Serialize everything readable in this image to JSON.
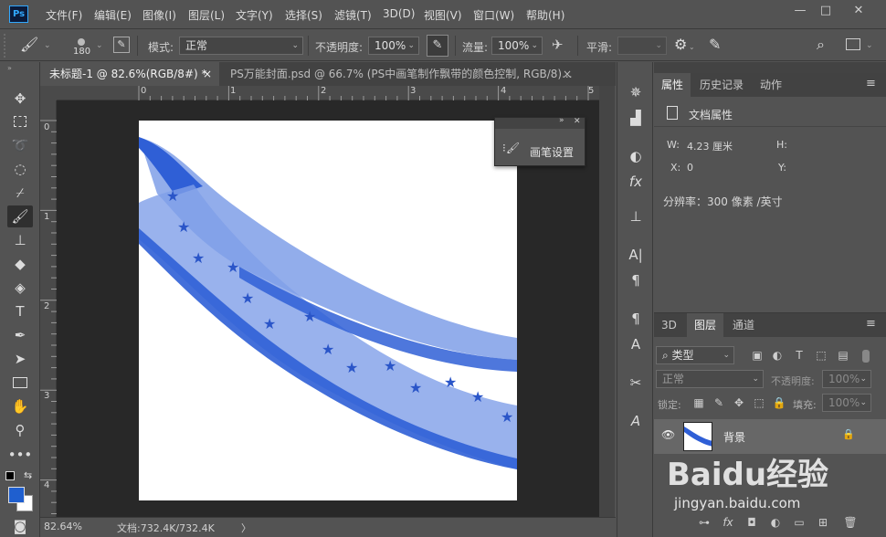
{
  "app": {
    "logo": "Ps"
  },
  "menu": [
    "文件(F)",
    "编辑(E)",
    "图像(I)",
    "图层(L)",
    "文字(Y)",
    "选择(S)",
    "滤镜(T)",
    "3D(D)",
    "视图(V)",
    "窗口(W)",
    "帮助(H)"
  ],
  "window_controls": {
    "minimize": "—",
    "maximize": "□",
    "close": "✕"
  },
  "options": {
    "brush_size": "180",
    "mode_label": "模式:",
    "mode_value": "正常",
    "opacity_label": "不透明度:",
    "opacity_value": "100%",
    "flow_label": "流量:",
    "flow_value": "100%",
    "smooth_label": "平滑:",
    "smooth_value": ""
  },
  "tabs": [
    {
      "label": "未标题-1 @ 82.6%(RGB/8#) *",
      "close": "×"
    },
    {
      "label": "PS万能封面.psd @ 66.7% (PS中画笔制作飘带的颜色控制, RGB/8)...",
      "close": "×"
    }
  ],
  "ruler_top": [
    "0",
    "1",
    "2",
    "3",
    "4",
    "5"
  ],
  "ruler_left": [
    "0",
    "1",
    "2",
    "3",
    "4"
  ],
  "brush_panel": {
    "title": "画笔设置"
  },
  "status": {
    "zoom": "82.64%",
    "doc_info": "文档:732.4K/732.4K",
    "arrow": "〉"
  },
  "properties": {
    "tabs": [
      "属性",
      "历史记录",
      "动作"
    ],
    "doc_title": "文档属性",
    "w_label": "W:",
    "w_value": "4.23 厘米",
    "h_label": "H:",
    "x_label": "X:",
    "x_value": "0",
    "y_label": "Y:",
    "resolution": "分辨率：300 像素 /英寸"
  },
  "layers": {
    "tabs": [
      "3D",
      "图层",
      "通道"
    ],
    "kind_label": "类型",
    "blend_mode": "正常",
    "opacity_label": "不透明度:",
    "opacity_value": "100%",
    "lock_label": "锁定:",
    "fill_label": "填充:",
    "fill_value": "100%",
    "layer_name": "背景"
  },
  "watermark": {
    "text": "Baidu经验",
    "url": "jingyan.baidu.com"
  },
  "colors": {
    "ribbon": "#2f5fd6",
    "ribbon_light": "#7f9fe8",
    "foreground": "#1f5fcf",
    "background": "#ffffff"
  }
}
